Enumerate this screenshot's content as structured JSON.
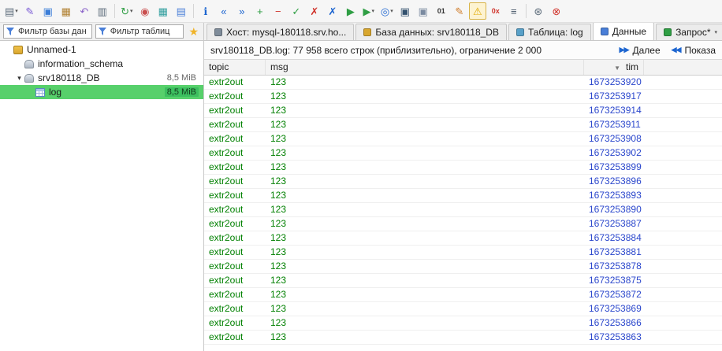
{
  "colors": {
    "selection_green": "#57d06b",
    "selection_badge_green": "#3cbf5f",
    "row_text_green": "#008000",
    "number_blue": "#2b47cc"
  },
  "toolbar": {
    "items": [
      {
        "name": "session-manager-icon",
        "glyph": "▤",
        "color": "#5b6b7a",
        "caret": true
      },
      {
        "name": "connect-icon",
        "glyph": "✎",
        "color": "#7b5cd6"
      },
      {
        "name": "copy-icon",
        "glyph": "▣",
        "color": "#3b7dd8"
      },
      {
        "name": "paste-icon",
        "glyph": "▦",
        "color": "#b08030"
      },
      {
        "name": "undo-icon",
        "glyph": "↶",
        "color": "#8a63c9"
      },
      {
        "name": "print-icon",
        "glyph": "▥",
        "color": "#5b6b7a"
      },
      {
        "sep": true
      },
      {
        "name": "refresh-icon",
        "glyph": "↻",
        "color": "#2f9e44",
        "caret": true
      },
      {
        "name": "user-manager-icon",
        "glyph": "◉",
        "color": "#c94f4f"
      },
      {
        "name": "create-table-icon",
        "glyph": "▦",
        "color": "#2f9e9e"
      },
      {
        "name": "table-tools-icon",
        "glyph": "▤",
        "color": "#4a7fd8"
      },
      {
        "sep": true
      },
      {
        "name": "info-icon",
        "glyph": "ℹ",
        "color": "#1e66d0"
      },
      {
        "name": "first-record-icon",
        "glyph": "«",
        "color": "#1e66d0"
      },
      {
        "name": "last-record-icon",
        "glyph": "»",
        "color": "#1e66d0"
      },
      {
        "name": "add-record-icon",
        "glyph": "+",
        "color": "#2f9e44"
      },
      {
        "name": "delete-record-icon",
        "glyph": "−",
        "color": "#d0342c"
      },
      {
        "name": "post-changes-icon",
        "glyph": "✓",
        "color": "#2f9e44"
      },
      {
        "name": "revert-changes-icon",
        "glyph": "✗",
        "color": "#d0342c"
      },
      {
        "name": "cancel-operation-icon",
        "glyph": "✗",
        "color": "#1e66d0"
      },
      {
        "name": "run-query-icon",
        "glyph": "▶",
        "color": "#2f9e44"
      },
      {
        "name": "run-selection-icon",
        "glyph": "▶",
        "color": "#2f9e44",
        "caret": true
      },
      {
        "name": "find-icon",
        "glyph": "◎",
        "color": "#1e66d0",
        "caret": true
      },
      {
        "name": "save-icon",
        "glyph": "▣",
        "color": "#33516e"
      },
      {
        "name": "save-as-icon",
        "glyph": "▣",
        "color": "#7a8aa0"
      },
      {
        "name": "binary-view-icon",
        "glyph": "01",
        "color": "#333333"
      },
      {
        "name": "edit-icon",
        "glyph": "✎",
        "color": "#d07d2c"
      },
      {
        "name": "warning-filter-icon",
        "glyph": "⚠",
        "color": "#e0a800",
        "pressed": true
      },
      {
        "name": "hex-view-icon",
        "glyph": "0x",
        "color": "#d0342c"
      },
      {
        "name": "sql-log-icon",
        "glyph": "≡",
        "color": "#445566"
      },
      {
        "sep": true
      },
      {
        "name": "settings-icon",
        "glyph": "⊛",
        "color": "#5b6b7a"
      },
      {
        "name": "stop-icon",
        "glyph": "⊗",
        "color": "#d0342c"
      }
    ]
  },
  "filters": {
    "database_filter": "Фильтр базы дан",
    "table_filter": "Фильтр таблиц",
    "favorites_icon": "★"
  },
  "tabs": {
    "items": [
      {
        "name": "tab-host",
        "label": "Хост: mysql-180118.srv.ho...",
        "icon_color": "#7f8c9a"
      },
      {
        "name": "tab-database",
        "label": "База данных: srv180118_DB",
        "icon_color": "#d8a62e"
      },
      {
        "name": "tab-table",
        "label": "Таблица: log",
        "icon_color": "#58a0c8"
      },
      {
        "name": "tab-data",
        "label": "Данные",
        "icon_color": "#4a7fd8",
        "active": true
      },
      {
        "name": "tab-query",
        "label": "Запрос*",
        "icon_color": "#2f9e44",
        "caret": true
      }
    ]
  },
  "tree": {
    "items": [
      {
        "label": "Unnamed-1",
        "icon": "session-icon",
        "indent": 0,
        "chevron": ""
      },
      {
        "label": "information_schema",
        "icon": "database-icon",
        "indent": 1,
        "chevron": ""
      },
      {
        "label": "srv180118_DB",
        "icon": "database-icon",
        "indent": 1,
        "chevron": "▾",
        "size": "8,5 MiB"
      },
      {
        "label": "log",
        "icon": "table-icon",
        "indent": 2,
        "chevron": "",
        "size": "8,5 MiB",
        "selected": true
      }
    ]
  },
  "grid": {
    "status": "srv180118_DB.log: 77 958 всего строк (приблизительно), ограничение 2 000",
    "next_button": {
      "icon": "▶▶",
      "label": "Далее"
    },
    "show_all_button": {
      "icon": "◀◀",
      "label": "Показа"
    },
    "columns": [
      {
        "key": "topic",
        "label": "topic"
      },
      {
        "key": "msg",
        "label": "msg"
      },
      {
        "key": "tim",
        "label": "tim",
        "sorted": "desc",
        "sort_icon": "▼"
      }
    ],
    "rows": [
      {
        "topic": "extr2out",
        "msg": "123",
        "tim": "1673253920"
      },
      {
        "topic": "extr2out",
        "msg": "123",
        "tim": "1673253917"
      },
      {
        "topic": "extr2out",
        "msg": "123",
        "tim": "1673253914"
      },
      {
        "topic": "extr2out",
        "msg": "123",
        "tim": "1673253911"
      },
      {
        "topic": "extr2out",
        "msg": "123",
        "tim": "1673253908"
      },
      {
        "topic": "extr2out",
        "msg": "123",
        "tim": "1673253902"
      },
      {
        "topic": "extr2out",
        "msg": "123",
        "tim": "1673253899"
      },
      {
        "topic": "extr2out",
        "msg": "123",
        "tim": "1673253896"
      },
      {
        "topic": "extr2out",
        "msg": "123",
        "tim": "1673253893"
      },
      {
        "topic": "extr2out",
        "msg": "123",
        "tim": "1673253890"
      },
      {
        "topic": "extr2out",
        "msg": "123",
        "tim": "1673253887"
      },
      {
        "topic": "extr2out",
        "msg": "123",
        "tim": "1673253884"
      },
      {
        "topic": "extr2out",
        "msg": "123",
        "tim": "1673253881"
      },
      {
        "topic": "extr2out",
        "msg": "123",
        "tim": "1673253878"
      },
      {
        "topic": "extr2out",
        "msg": "123",
        "tim": "1673253875"
      },
      {
        "topic": "extr2out",
        "msg": "123",
        "tim": "1673253872"
      },
      {
        "topic": "extr2out",
        "msg": "123",
        "tim": "1673253869"
      },
      {
        "topic": "extr2out",
        "msg": "123",
        "tim": "1673253866"
      },
      {
        "topic": "extr2out",
        "msg": "123",
        "tim": "1673253863"
      }
    ]
  }
}
